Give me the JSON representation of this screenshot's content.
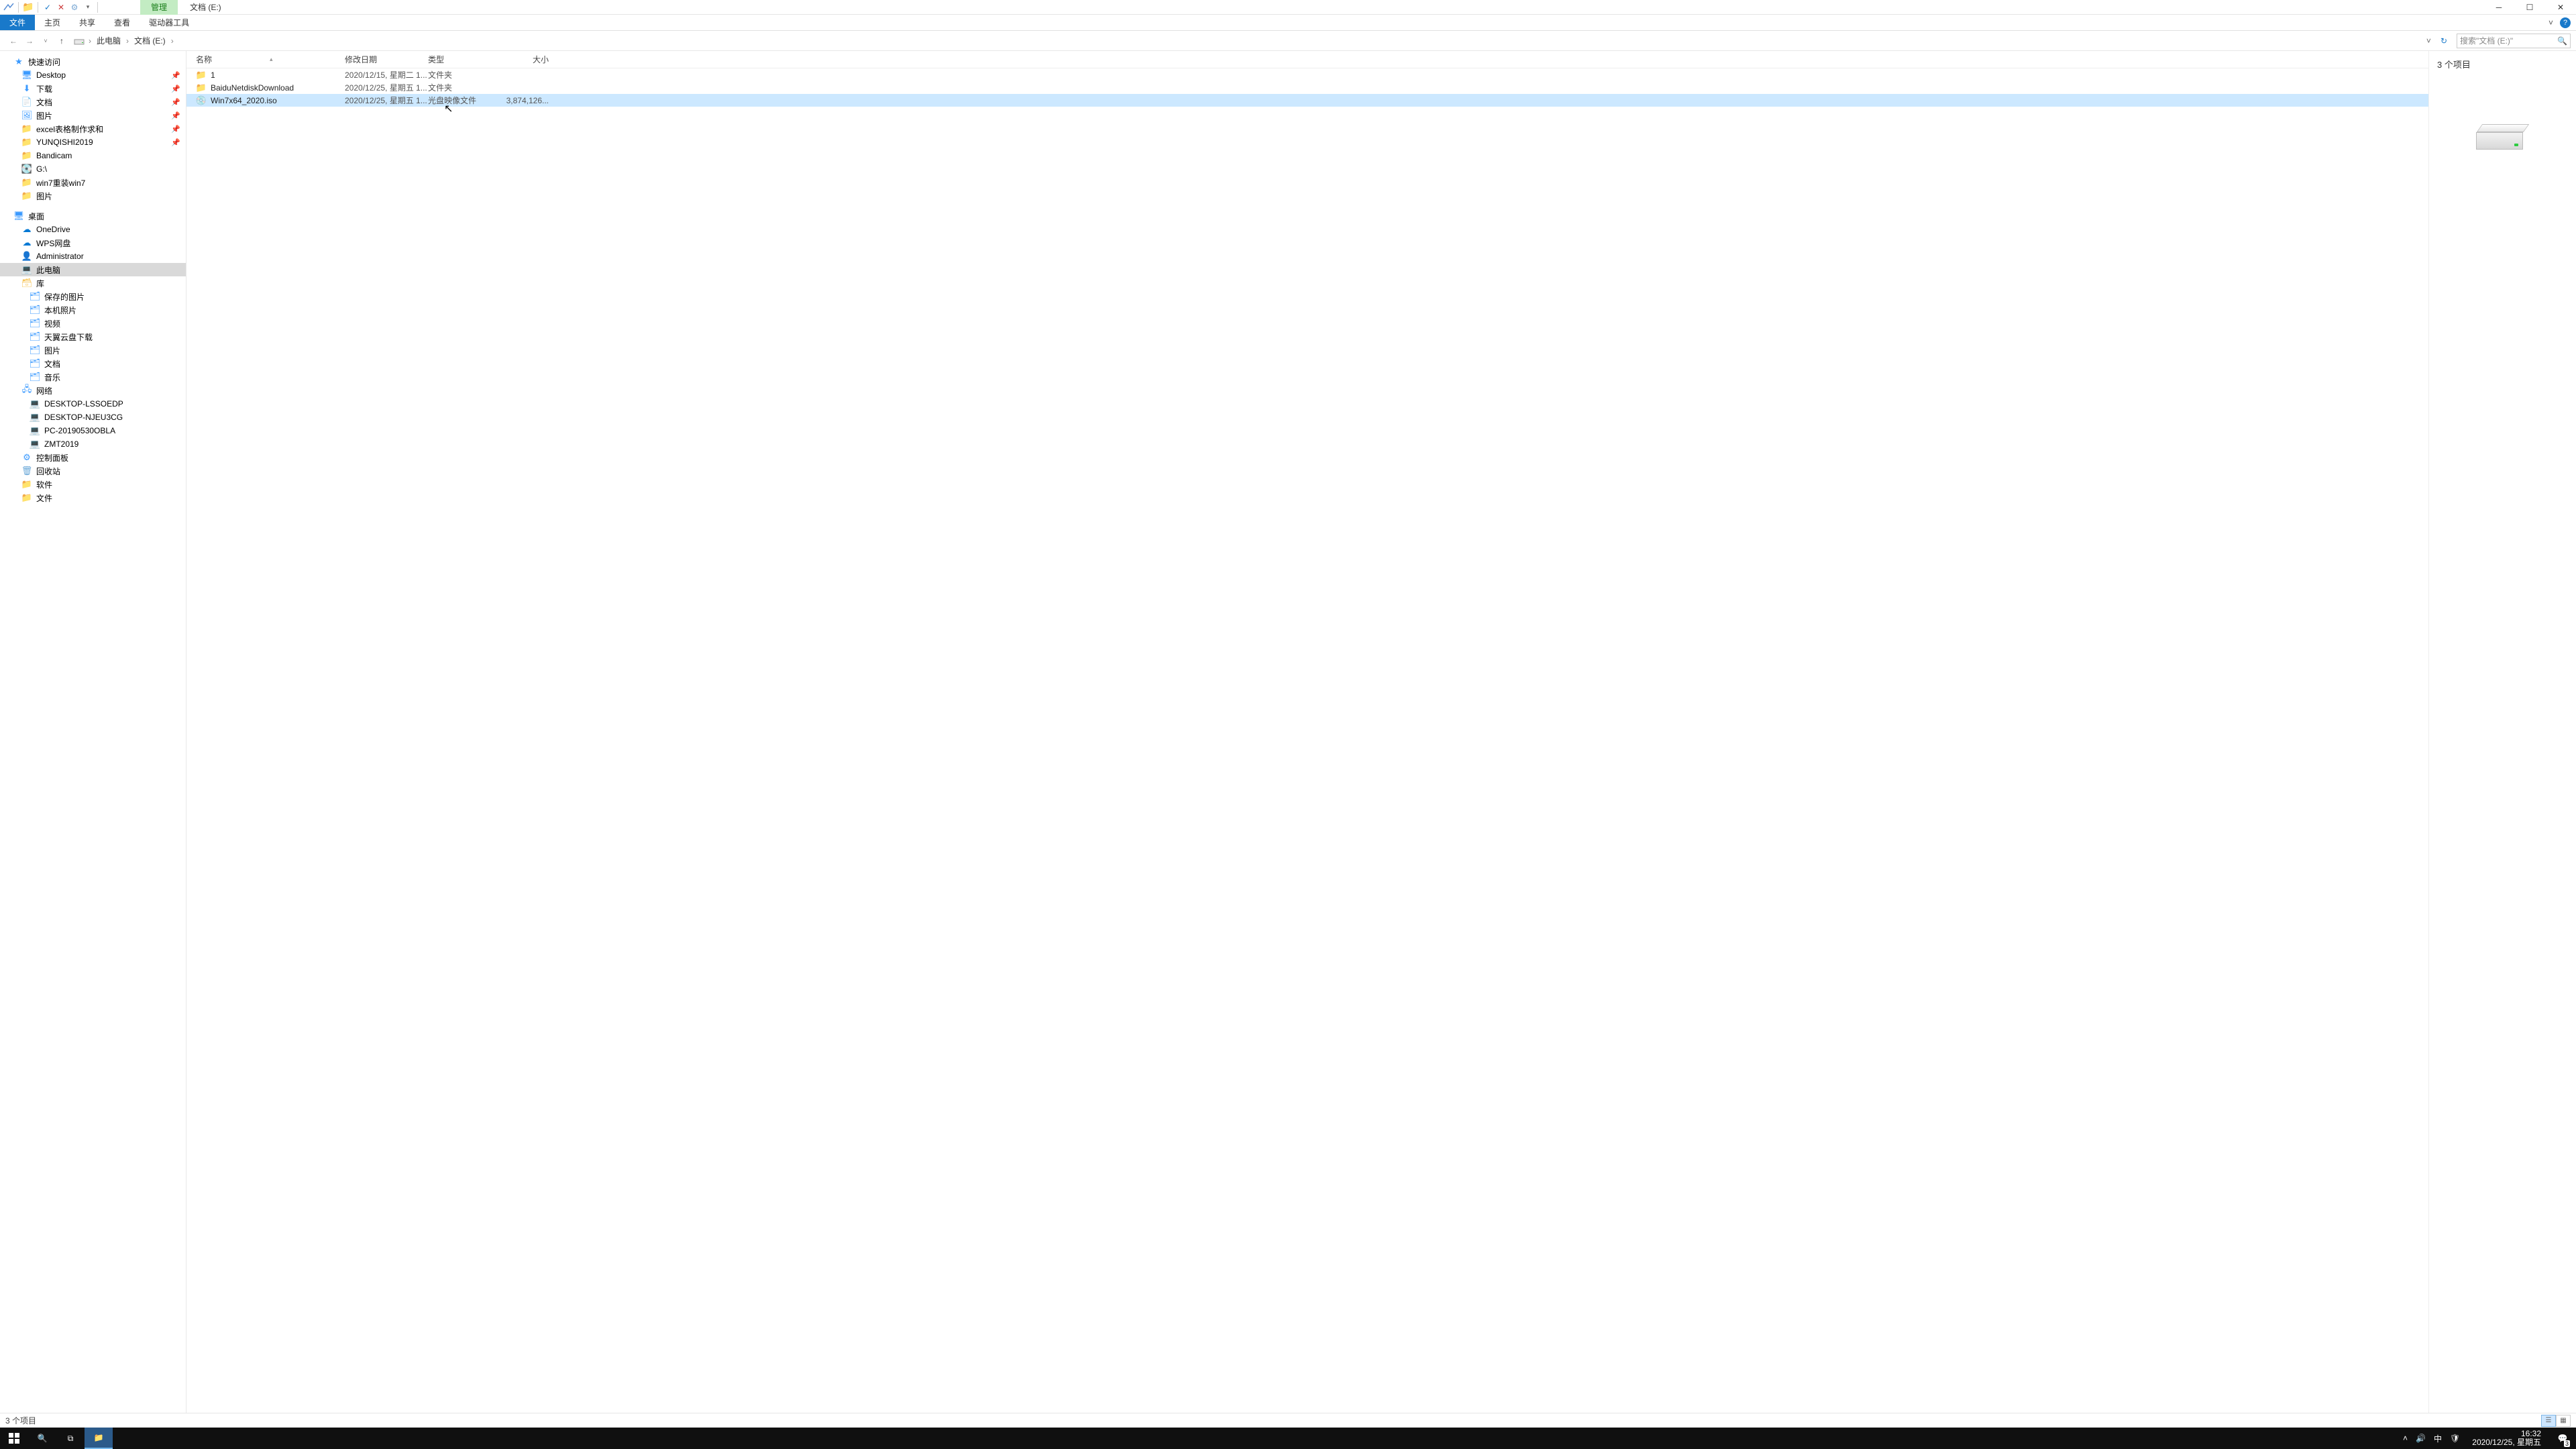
{
  "title": {
    "manage_tab": "管理",
    "location": "文档 (E:)"
  },
  "ribbon": {
    "file": "文件",
    "home": "主页",
    "share": "共享",
    "view": "查看",
    "drive_tools": "驱动器工具"
  },
  "breadcrumb": {
    "pc": "此电脑",
    "drive": "文档 (E:)"
  },
  "search": {
    "placeholder": "搜索\"文档 (E:)\""
  },
  "sidebar": {
    "quick_access": "快速访问",
    "items_quick": [
      {
        "label": "Desktop",
        "icon": "desktop"
      },
      {
        "label": "下载",
        "icon": "dl"
      },
      {
        "label": "文档",
        "icon": "doc"
      },
      {
        "label": "图片",
        "icon": "pic"
      },
      {
        "label": "excel表格制作求和",
        "icon": "folder"
      },
      {
        "label": "YUNQISHI2019",
        "icon": "folder"
      },
      {
        "label": "Bandicam",
        "icon": "folder"
      },
      {
        "label": "G:\\",
        "icon": "drive"
      },
      {
        "label": "win7重装win7",
        "icon": "folder"
      },
      {
        "label": "图片",
        "icon": "folder"
      }
    ],
    "desktop": "桌面",
    "onedrive": "OneDrive",
    "wps": "WPS网盘",
    "admin": "Administrator",
    "this_pc": "此电脑",
    "libraries": "库",
    "lib_items": [
      "保存的图片",
      "本机照片",
      "视频",
      "天翼云盘下载",
      "图片",
      "文档",
      "音乐"
    ],
    "network": "网络",
    "net_items": [
      "DESKTOP-LSSOEDP",
      "DESKTOP-NJEU3CG",
      "PC-20190530OBLA",
      "ZMT2019"
    ],
    "control_panel": "控制面板",
    "recycle": "回收站",
    "software": "软件",
    "files_folder": "文件"
  },
  "columns": {
    "name": "名称",
    "date": "修改日期",
    "type": "类型",
    "size": "大小"
  },
  "rows": [
    {
      "name": "1",
      "date": "2020/12/15, 星期二 1...",
      "type": "文件夹",
      "size": "",
      "icon": "folder",
      "sel": false
    },
    {
      "name": "BaiduNetdiskDownload",
      "date": "2020/12/25, 星期五 1...",
      "type": "文件夹",
      "size": "",
      "icon": "folder",
      "sel": false
    },
    {
      "name": "Win7x64_2020.iso",
      "date": "2020/12/25, 星期五 1...",
      "type": "光盘映像文件",
      "size": "3,874,126...",
      "icon": "iso",
      "sel": true
    }
  ],
  "preview": {
    "count": "3 个项目"
  },
  "status": {
    "items": "3 个项目"
  },
  "taskbar": {
    "time": "16:32",
    "date": "2020/12/25, 星期五",
    "ime": "中",
    "notif_count": "3"
  }
}
